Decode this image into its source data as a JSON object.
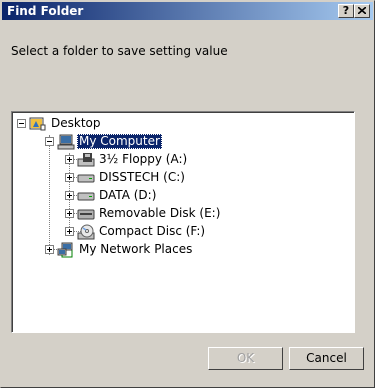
{
  "window": {
    "title": "Find Folder",
    "help_button": "?",
    "close_button": "X"
  },
  "prompt": "Select a folder to save setting value",
  "tree": {
    "desktop": {
      "label": "Desktop",
      "icon": "desktop-icon"
    },
    "my_computer": {
      "label": "My Computer",
      "icon": "my-computer-icon",
      "selected": true
    },
    "drives": [
      {
        "label": "3½ Floppy (A:)",
        "icon": "floppy-drive-icon"
      },
      {
        "label": "DISSTECH (C:)",
        "icon": "hard-drive-icon"
      },
      {
        "label": "DATA (D:)",
        "icon": "hard-drive-icon"
      },
      {
        "label": "Removable Disk (E:)",
        "icon": "removable-disk-icon"
      },
      {
        "label": "Compact Disc (F:)",
        "icon": "cd-drive-icon"
      }
    ],
    "network": {
      "label": "My Network Places",
      "icon": "network-places-icon"
    }
  },
  "buttons": {
    "ok": "OK",
    "cancel": "Cancel"
  },
  "colors": {
    "titlebar_start": "#0a246a",
    "titlebar_end": "#a6caf0",
    "selection": "#0a246a",
    "face": "#d4d0c8"
  }
}
